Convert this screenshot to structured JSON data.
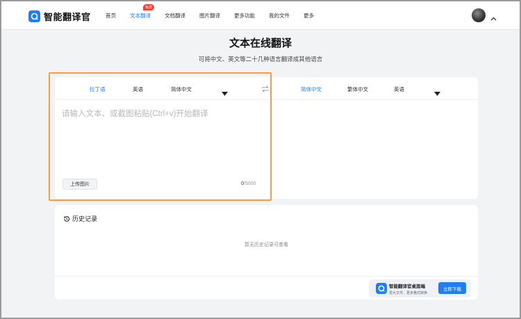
{
  "header": {
    "logo_text": "智能翻译官",
    "nav": [
      {
        "label": "首页"
      },
      {
        "label": "文本翻译",
        "badge": "免费",
        "active": true
      },
      {
        "label": "文档翻译"
      },
      {
        "label": "图片翻译"
      },
      {
        "label": "更多功能"
      },
      {
        "label": "我的文件"
      },
      {
        "label": "更多"
      }
    ]
  },
  "page": {
    "title": "文本在线翻译",
    "subtitle": "可将中文、英文等二十几种语言翻译成其他语言"
  },
  "translator": {
    "source_langs": [
      "拉丁语",
      "英语",
      "简体中文"
    ],
    "target_langs": [
      "简体中文",
      "繁体中文",
      "英语"
    ],
    "placeholder": "请输入文本、或截图粘贴(Ctrl+v)开始翻译",
    "upload_label": "上传图片",
    "char_count": "0",
    "char_limit": "/5000"
  },
  "history": {
    "title": "历史记录",
    "empty_text": "暂无历史记录可查看"
  },
  "promo": {
    "title": "智能翻译官桌面端",
    "subtitle": "更大文件、更多格式转换",
    "button": "立即下载"
  },
  "colors": {
    "accent": "#1f7ef5",
    "highlight": "#f59c44",
    "badge": "#ff3b30"
  }
}
